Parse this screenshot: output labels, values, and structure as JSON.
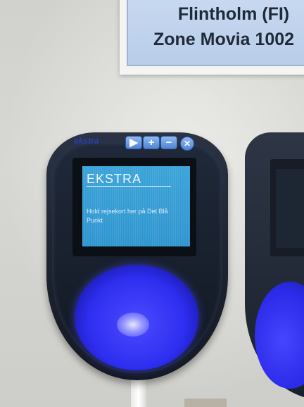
{
  "sign": {
    "line1": "Flintholm (FI)",
    "line2": "Zone Movia 1002"
  },
  "reader": {
    "brand": "ekstra",
    "controls": [
      "▶",
      "+",
      "−",
      "✕"
    ],
    "screen_title": "EKSTRA",
    "screen_message": "Hold rejsekort her på Det Blå Punkt"
  }
}
